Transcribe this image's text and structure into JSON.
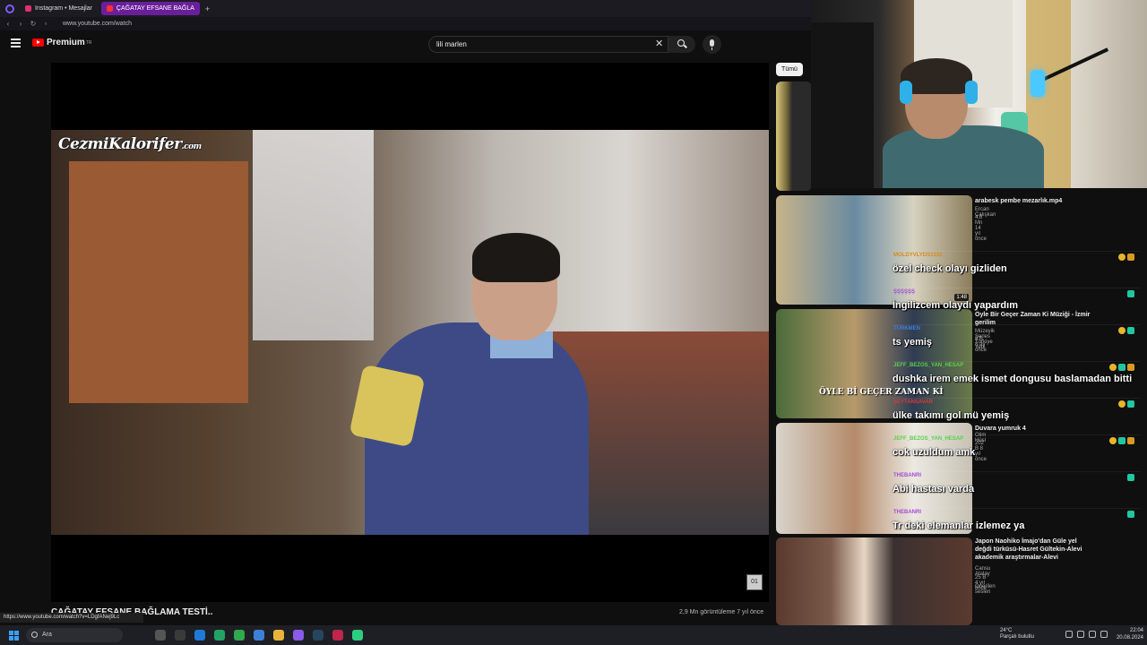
{
  "browser": {
    "tabs": [
      {
        "label": "Instagram • Mesajlar",
        "active": false,
        "color": "#e1306c"
      },
      {
        "label": "ÇAĞATAY EFSANE BAĞLA",
        "active": true,
        "color": "#ff0000"
      }
    ],
    "url": "www.youtube.com/watch"
  },
  "youtube": {
    "logo_text": "Premium",
    "logo_sup": "TR",
    "search_value": "lili marlen"
  },
  "player": {
    "watermark_main": "CezmiKalorifer",
    "watermark_suffix": ".com",
    "corner_icon_text": "01",
    "title": "ÇAĞATAY EFSANE BAĞLAMA TESTİ..",
    "meta": "2,9 Mn görüntüleme  7 yıl önce",
    "status_url": "https://www.youtube.com/watch?v=LDgfANej9Lc"
  },
  "sidebar": {
    "chip_all": "Tümü",
    "recs": [
      {
        "title": "arabesk pembe mezarlık.mp4",
        "channel": "Ercan Çalışkan",
        "stats": "4,6 Mn  14 yıl önce",
        "duration": "1:48"
      },
      {
        "title": "Öyle Bir Geçer Zaman Ki Müziği - İzmir gerilim",
        "channel": "Müzeyik Series Türkiye",
        "stats": "8 B  8 ay önce",
        "extra": "Yeni",
        "thumb_text": "ÖYLE Bİ GEÇER ZAMAN Kİ"
      },
      {
        "title": "Duvara yumruk 4",
        "channel": "Olim Hüsl",
        "stats": "202 B  8 yıl önce"
      },
      {
        "title": "Japon Naohiko İmajo'dan Güle yel değdi türküsü-Hasret Gültekin-Alevi akademik araştırmalar-Alevi",
        "channel": "Cansu Atalay",
        "stats": "25 B  4 yıl önce",
        "extra": "Önerilen sesleri"
      }
    ]
  },
  "chat": {
    "messages": [
      {
        "user": "MOLDYVLYDS1232",
        "user_color": "#d88a1f",
        "text": "özel check olayı gizliden",
        "badges": [
          "gold",
          "crown"
        ]
      },
      {
        "user": "ŞŞŞŞŞŞ",
        "user_color": "#a64dd8",
        "text": "İngilizcem olaydı yapardım",
        "badges": [
          "green"
        ]
      },
      {
        "user": "TÜRKMEN",
        "user_color": "#3d7fe0",
        "text": "ts yemiş",
        "badges": [
          "gold",
          "green"
        ]
      },
      {
        "user": "JEFF_BEZOS_YAN_HESAP",
        "user_color": "#5ad14a",
        "text": "dushka irem emek ismet dongusu baslamadan bitti",
        "badges": [
          "gold",
          "green",
          "crown"
        ]
      },
      {
        "user": "ŞEYTANSAVAR",
        "user_color": "#d83a3a",
        "text": "ülke takımı gol mü yemiş",
        "badges": [
          "gold",
          "green"
        ]
      },
      {
        "user": "JEFF_BEZOS_YAN_HESAP",
        "user_color": "#5ad14a",
        "text": "cok uzuldum amk",
        "badges": [
          "gold",
          "green",
          "crown"
        ]
      },
      {
        "user": "THEBANRI",
        "user_color": "#a64dd8",
        "text": "Abi hastası varda",
        "badges": [
          "green"
        ]
      },
      {
        "user": "THEBANRI",
        "user_color": "#a64dd8",
        "text": "Tr deki elemanlar izlemez ya",
        "badges": [
          "green"
        ]
      }
    ]
  },
  "taskbar": {
    "search_placeholder": "Ara",
    "weather_temp": "24°C",
    "weather_desc": "Parçalı bulutlu",
    "time": "22:04",
    "date": "20.08.2024"
  }
}
